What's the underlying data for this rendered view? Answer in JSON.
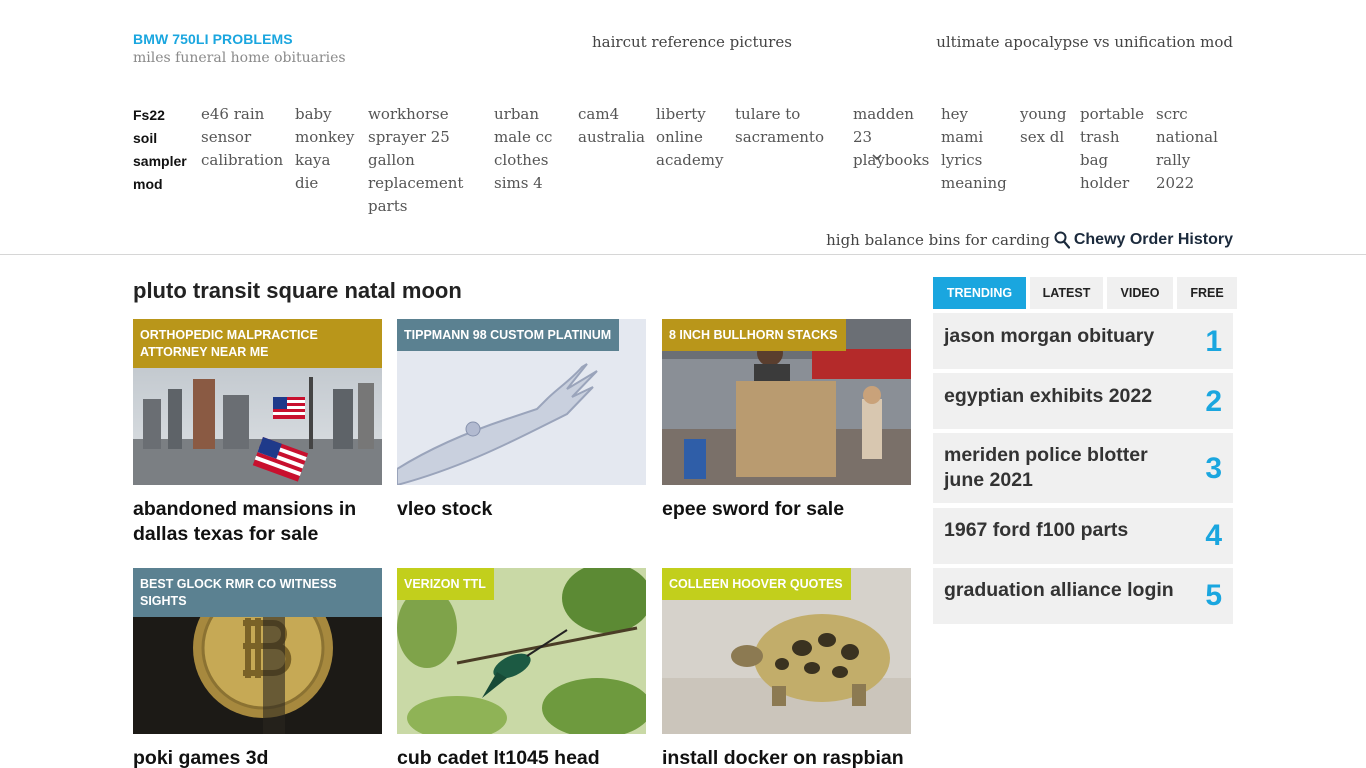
{
  "header": {
    "brand_title": "BMW 750LI PROBLEMS",
    "brand_subtitle": "miles funeral home obituaries",
    "top_links": [
      "haircut reference pictures",
      "ultimate apocalypse vs unification mod"
    ]
  },
  "nav": {
    "items": [
      {
        "lines": [
          "Fs22",
          "soil",
          "sampler",
          "mod"
        ]
      },
      {
        "lines": [
          "e46 rain",
          "sensor",
          "calibration"
        ]
      },
      {
        "lines": [
          "baby",
          "monkey",
          "kaya",
          "die"
        ]
      },
      {
        "lines": [
          "workhorse",
          "sprayer 25",
          "gallon",
          "replacement",
          "parts"
        ]
      },
      {
        "lines": [
          "urban",
          "male cc",
          "clothes",
          "sims 4"
        ]
      },
      {
        "lines": [
          "cam4",
          "australia"
        ]
      },
      {
        "lines": [
          "liberty",
          "online",
          "academy"
        ]
      },
      {
        "lines": [
          "tulare to",
          "sacramento"
        ]
      },
      {
        "lines": [
          "madden",
          "23",
          "playbooks"
        ]
      },
      {
        "lines": [
          "hey",
          "mami",
          "lyrics",
          "meaning"
        ]
      },
      {
        "lines": [
          "young",
          "sex dl"
        ]
      },
      {
        "lines": [
          "portable",
          "trash",
          "bag",
          "holder"
        ]
      },
      {
        "lines": [
          "scrc",
          "national",
          "rally",
          "2022"
        ]
      }
    ],
    "dropdown_icon": "chevron-down-icon"
  },
  "search": {
    "text": "high balance bins for carding",
    "icon": "search-icon",
    "strong": "Chewy Order History"
  },
  "main": {
    "section_title": "pluto transit square natal moon",
    "cards": [
      {
        "badge": "ORTHOPEDIC MALPRACTICE ATTORNEY NEAR ME",
        "badge_color": "#b9961a",
        "headline": "abandoned mansions in dallas texas for sale",
        "image": "refinery with american flag"
      },
      {
        "badge": "TIPPMANN 98 CUSTOM PLATINUM",
        "badge_color": "#5b8191",
        "headline": "vleo stock",
        "image": "robotic hand"
      },
      {
        "badge": "8 INCH BULLHORN STACKS",
        "badge_color": "#b9961a",
        "headline": "epee sword for sale",
        "image": "protester with climate sign"
      },
      {
        "badge": "BEST GLOCK RMR CO WITNESS SIGHTS",
        "badge_color": "#5b8191",
        "headline": "poki games 3d",
        "image": "bitcoin coin"
      },
      {
        "badge": "VERIZON TTL",
        "badge_color": "#c2cf1c",
        "headline": "cub cadet lt1045 head",
        "image": "hummingbird"
      },
      {
        "badge": "COLLEEN HOOVER QUOTES",
        "badge_color": "#c2cf1c",
        "headline": "install docker on raspbian",
        "image": "tortoise"
      }
    ]
  },
  "sidebar": {
    "tabs": [
      "TRENDING",
      "LATEST",
      "VIDEO",
      "FREE"
    ],
    "active_tab": "TRENDING",
    "trending": [
      {
        "text": "jason morgan obituary",
        "num": "1"
      },
      {
        "text": "egyptian exhibits 2022",
        "num": "2"
      },
      {
        "text": "meriden police blotter june 2021",
        "num": "3"
      },
      {
        "text": "1967 ford f100 parts",
        "num": "4"
      },
      {
        "text": "graduation alliance login",
        "num": "5"
      }
    ]
  },
  "colors": {
    "accent": "#1aa6df",
    "gold": "#b9961a",
    "slate": "#5b8191",
    "lime": "#c2cf1c"
  }
}
